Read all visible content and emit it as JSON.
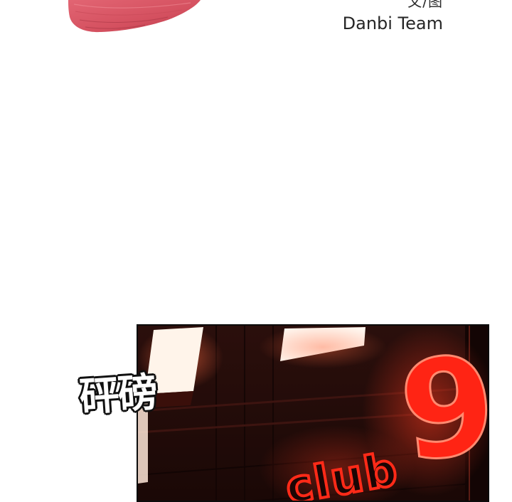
{
  "credits": {
    "role": "文/图",
    "team": "Danbi Team"
  },
  "panel": {
    "sign_word": "club",
    "sign_number": "9",
    "sign_color": "#ff1a0e",
    "wall_color": "#2a0e0b"
  },
  "sfx": {
    "text": "砰磅"
  },
  "brush_color": "#d95766"
}
